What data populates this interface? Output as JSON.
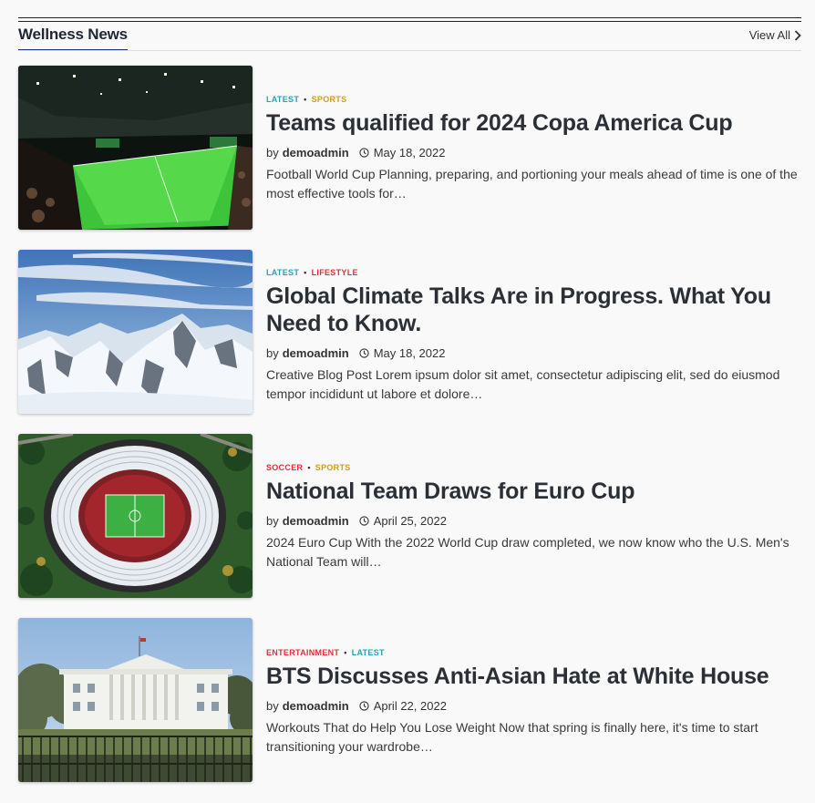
{
  "section": {
    "title": "Wellness News",
    "view_all": "View All"
  },
  "colors": {
    "latest": "#2aa1b3",
    "sports": "#d19a1e",
    "lifestyle": "#e0303a",
    "soccer": "#e0303a",
    "entertainment": "#e0303a",
    "accent_underline": "#1a3a6e"
  },
  "posts": [
    {
      "categories": [
        {
          "label": "LATEST",
          "color": "#2aa1b3"
        },
        {
          "label": "SPORTS",
          "color": "#d19a1e"
        }
      ],
      "headline": "Teams qualified for 2024 Copa America Cup",
      "by": "by",
      "author": "demoadmin",
      "date": "May 18, 2022",
      "excerpt": "Football World Cup Planning, preparing, and portioning your meals ahead of time is one of the most effective tools for…",
      "image": "stadium-night-image"
    },
    {
      "categories": [
        {
          "label": "LATEST",
          "color": "#2aa1b3"
        },
        {
          "label": "LIFESTYLE",
          "color": "#e0303a"
        }
      ],
      "headline": "Global Climate Talks Are in Progress. What You Need to Know.",
      "by": "by",
      "author": "demoadmin",
      "date": "May 18, 2022",
      "excerpt": "Creative Blog Post Lorem ipsum dolor sit amet, consectetur adipiscing elit, sed do eiusmod tempor incididunt ut labore et dolore…",
      "image": "snowy-mountains-image"
    },
    {
      "categories": [
        {
          "label": "SOCCER",
          "color": "#e0303a"
        },
        {
          "label": "SPORTS",
          "color": "#d19a1e"
        }
      ],
      "headline": "National Team Draws for Euro Cup",
      "by": "by",
      "author": "demoadmin",
      "date": "April 25, 2022",
      "excerpt": "2024 Euro Cup With the 2022 World Cup draw completed, we now know who the U.S. Men's National Team will…",
      "image": "stadium-aerial-image"
    },
    {
      "categories": [
        {
          "label": "ENTERTAINMENT",
          "color": "#e0303a"
        },
        {
          "label": "LATEST",
          "color": "#2aa1b3"
        }
      ],
      "headline": "BTS Discusses Anti-Asian Hate at White House",
      "by": "by",
      "author": "demoadmin",
      "date": "April 22, 2022",
      "excerpt": "Workouts That do Help You Lose Weight Now that spring is finally here, it's time to start transitioning your wardrobe…",
      "image": "white-house-image"
    }
  ]
}
